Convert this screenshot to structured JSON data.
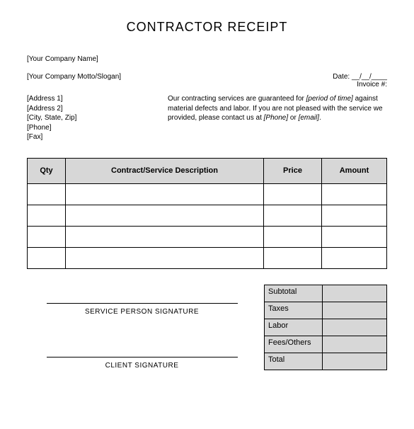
{
  "title": "CONTRACTOR RECEIPT",
  "company": {
    "name": "[Your Company Name]",
    "motto": "[Your Company Motto/Slogan]",
    "address1": "[Address 1]",
    "address2": "[Address 2]",
    "city_state_zip": "[City, State, Zip]",
    "phone": "[Phone]",
    "fax": "[Fax]"
  },
  "meta": {
    "date_label": "Date: __/__/____",
    "invoice_label": "Invoice #:"
  },
  "guarantee": {
    "pre": "Our contracting services are guaranteed for ",
    "period": "[period of time]",
    "mid": " against material defects and labor. If you are not pleased with the service we provided, please contact us at ",
    "phone": "[Phone]",
    "or": " or ",
    "email": "[email]",
    "end": "."
  },
  "columns": {
    "qty": "Qty",
    "desc": "Contract/Service Description",
    "price": "Price",
    "amount": "Amount"
  },
  "rows": [
    {
      "qty": "",
      "desc": "",
      "price": "",
      "amount": ""
    },
    {
      "qty": "",
      "desc": "",
      "price": "",
      "amount": ""
    },
    {
      "qty": "",
      "desc": "",
      "price": "",
      "amount": ""
    },
    {
      "qty": "",
      "desc": "",
      "price": "",
      "amount": ""
    }
  ],
  "totals": {
    "subtotal": "Subtotal",
    "taxes": "Taxes",
    "labor": "Labor",
    "fees": "Fees/Others",
    "total": "Total"
  },
  "signatures": {
    "service": "SERVICE PERSON SIGNATURE",
    "client": "CLIENT SIGNATURE"
  }
}
